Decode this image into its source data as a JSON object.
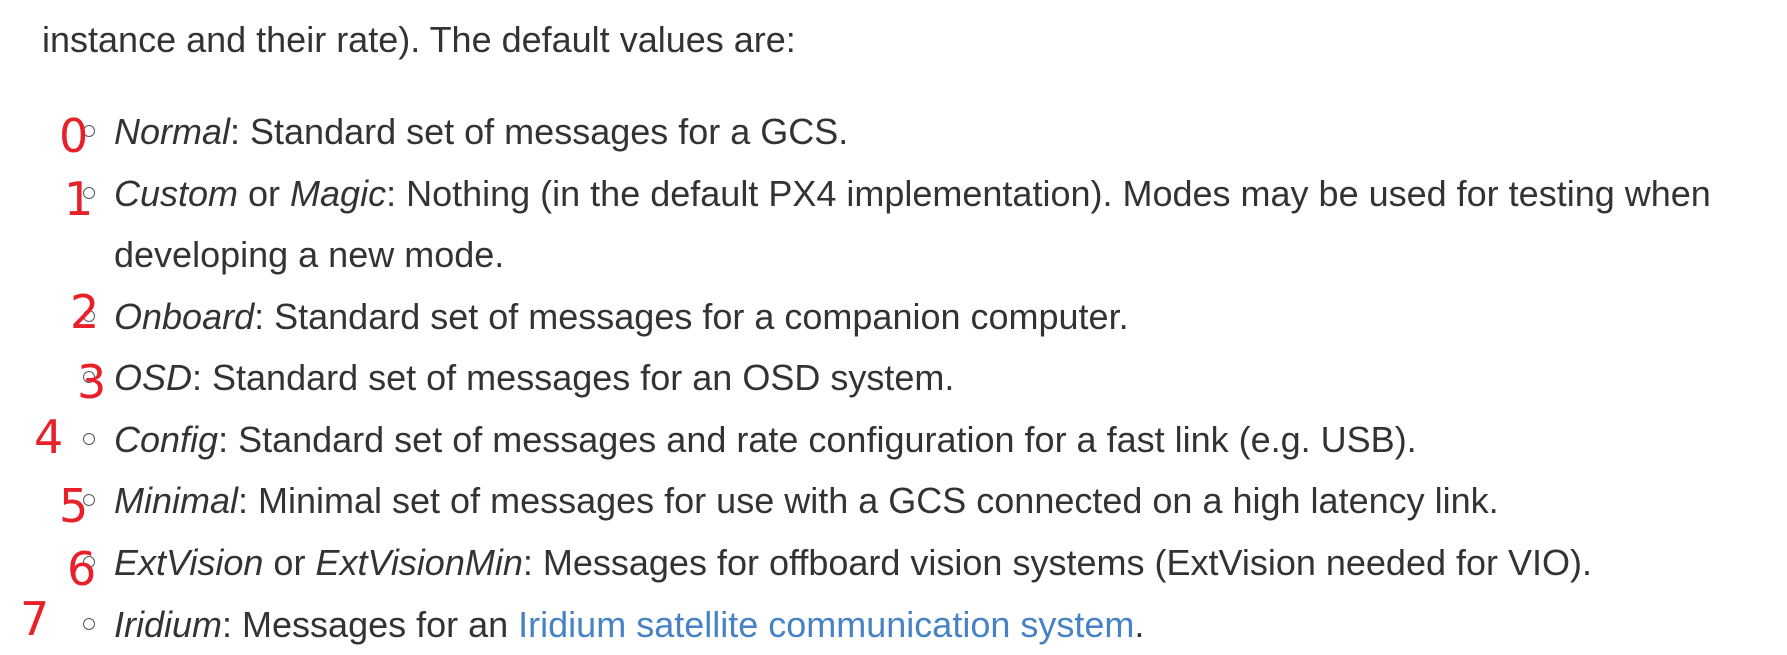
{
  "intro": "instance and their rate). The default values are:",
  "modes": [
    {
      "number": "0",
      "name": "Normal",
      "rest": ": Standard set of messages for a GCS."
    },
    {
      "number": "1",
      "name": "Custom",
      "joiner": " or ",
      "name2": "Magic",
      "rest": ": Nothing (in the default PX4 implementation). Modes may be used for testing when developing a new mode."
    },
    {
      "number": "2",
      "name": "Onboard",
      "rest": ": Standard set of messages for a companion computer."
    },
    {
      "number": "3",
      "name": "OSD",
      "rest": ": Standard set of messages for an OSD system."
    },
    {
      "number": "4",
      "name": "Config",
      "rest": ": Standard set of messages and rate configuration for a fast link (e.g. USB)."
    },
    {
      "number": "5",
      "name": "Minimal",
      "rest": ": Minimal set of messages for use with a GCS connected on a high latency link."
    },
    {
      "number": "6",
      "name": "ExtVision",
      "joiner": " or ",
      "name2": "ExtVisionMin",
      "rest": ": Messages for offboard vision systems (ExtVision needed for VIO)."
    },
    {
      "number": "7",
      "name": "Iridium",
      "rest_before_link": ": Messages for an ",
      "link": "Iridium satellite communication system",
      "rest_after_link": "."
    }
  ],
  "colors": {
    "text": "#333333",
    "link": "#4682c4",
    "annotation": "#e8202a"
  }
}
